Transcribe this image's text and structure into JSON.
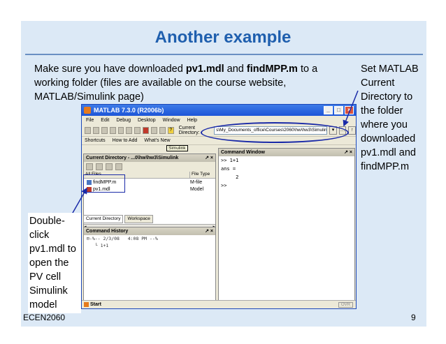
{
  "slide": {
    "title": "Another example",
    "body_pre": "Make sure you have downloaded ",
    "body_file1": "pv1.mdl",
    "body_and": " and ",
    "body_file2": "findMPP.m",
    "body_post": " to a working folder (files are available on the course website, MATLAB/Simulink page)",
    "side_note": "Set MATLAB Current Directory to the folder where you downloaded pv1.mdl and findMPP.m",
    "left_note": "Double-click pv1.mdl to open the PV cell Simulink model",
    "footer_left": "ECEN2060",
    "page_number": "9"
  },
  "matlab": {
    "window_title": "MATLAB  7.3.0 (R2006b)",
    "menus": [
      "File",
      "Edit",
      "Debug",
      "Desktop",
      "Window",
      "Help"
    ],
    "current_dir_label": "Current Directory:",
    "current_dir_value": "s\\My_Documents_office\\Courses\\2060\\hw\\hw3\\Simulink",
    "shortcuts": [
      "Shortcuts",
      "How to Add",
      "What's New"
    ],
    "tooltip": "Simulink",
    "current_dir_pane_title": "Current Directory - ...0\\hw\\hw3\\Simulink",
    "file_header_name": "All Files",
    "file_header_type": "File Type",
    "files": [
      {
        "name": "findMPP.m",
        "type": "M-file"
      },
      {
        "name": "pv1.mdl",
        "type": "Model"
      }
    ],
    "tabs": [
      "Current Directory",
      "Workspace"
    ],
    "history_title": "Command History",
    "history_lines": [
      "⊟-%-- 2/3/08   4:08 PM --%",
      "   └ 1+1"
    ],
    "command_window_title": "Command Window",
    "command_lines": [
      ">> 1+1",
      "",
      "ans =",
      "",
      "     2",
      "",
      ">>"
    ],
    "start_label": "Start",
    "status_ovr": "OVR"
  }
}
